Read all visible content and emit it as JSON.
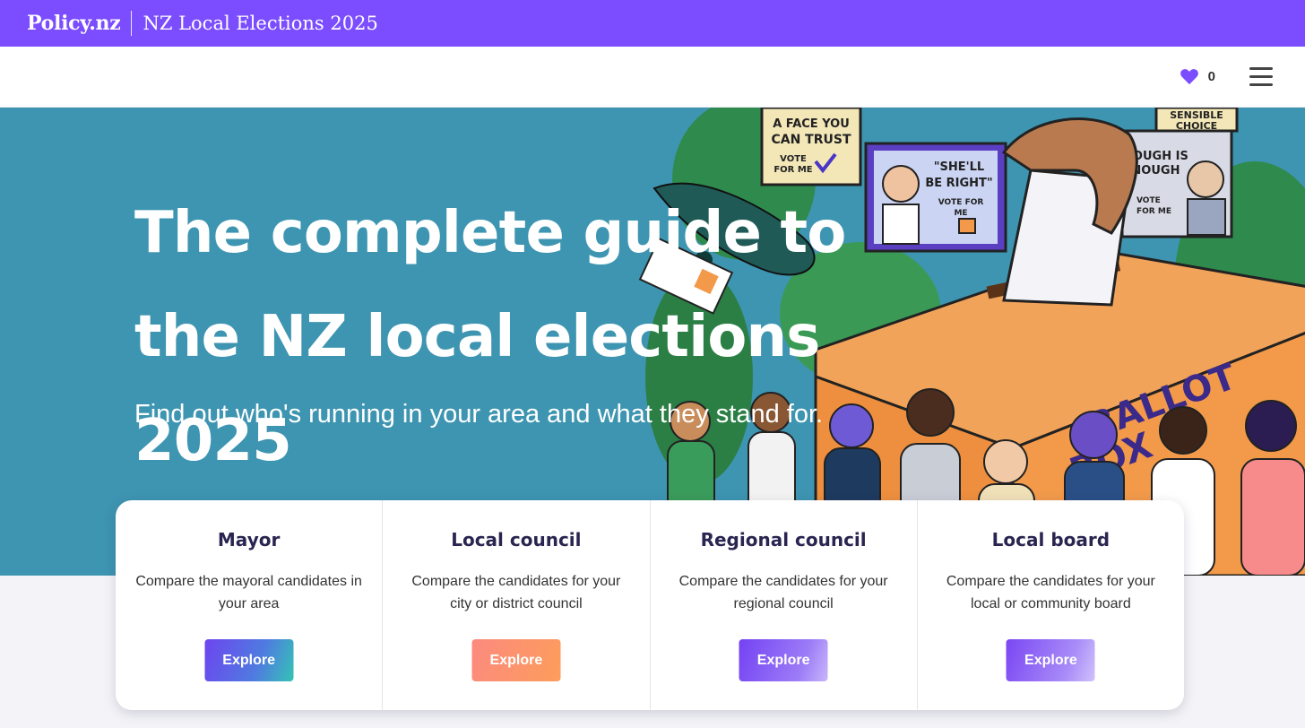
{
  "header": {
    "brand": "Policy.nz",
    "site_title": "NZ Local Elections 2025"
  },
  "nav": {
    "favourites_count": "0",
    "favourites_icon": "heart-icon",
    "menu_icon": "hamburger-menu-icon"
  },
  "hero": {
    "title_line1": "The complete guide to",
    "title_line2": "the NZ local elections 2025",
    "subtitle": "Find out who's running in your area and what they stand for.",
    "background_color": "#3e95b1"
  },
  "cards": [
    {
      "title": "Mayor",
      "description": "Compare the mayoral candidates in your area",
      "button": "Explore"
    },
    {
      "title": "Local council",
      "description": "Compare the candidates for your city or district council",
      "button": "Explore"
    },
    {
      "title": "Regional council",
      "description": "Compare the candidates for your regional council",
      "button": "Explore"
    },
    {
      "title": "Local board",
      "description": "Compare the candidates for your local or community board",
      "button": "Explore"
    }
  ],
  "illustration_text": {
    "sign1": "A FACE YOU CAN TRUST",
    "sign1_vote": "VOTE FOR ME",
    "sign2": "\"SHE'LL BE RIGHT\"",
    "sign2_vote": "VOTE FOR ME",
    "sign3": "ENOUGH IS ENOUGH",
    "sign3_vote": "VOTE FOR ME",
    "sign4": "SENSIBLE CHOICE",
    "box": "BALLOT BOX"
  },
  "colors": {
    "brand_purple": "#7b4dff",
    "hero_teal": "#3e95b1",
    "ballot_orange": "#f29a4a"
  }
}
